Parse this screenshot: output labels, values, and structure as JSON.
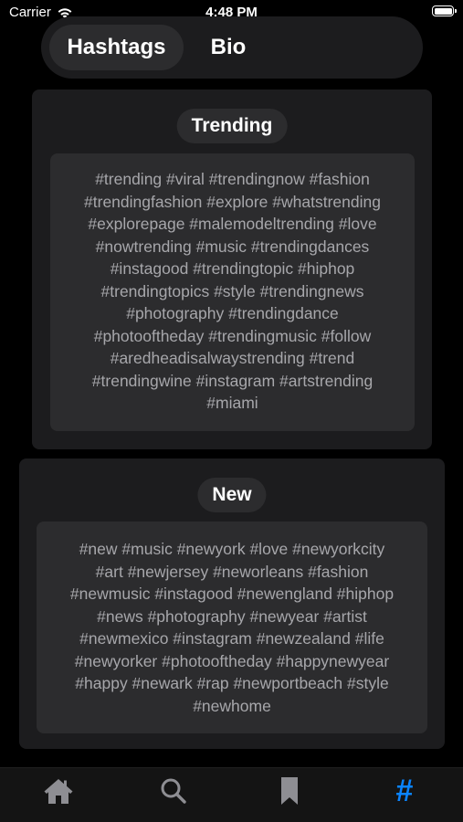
{
  "status_bar": {
    "carrier": "Carrier",
    "time": "4:48 PM"
  },
  "segmented_control": {
    "options": [
      {
        "label": "Hashtags",
        "selected": true
      },
      {
        "label": "Bio",
        "selected": false
      }
    ]
  },
  "sections": [
    {
      "title": "Trending",
      "lines": [
        "#trending #viral #trendingnow #fashion",
        "#trendingfashion #explore #whatstrending",
        "#explorepage #malemodeltrending #love",
        "#nowtrending #music #trendingdances",
        "#instagood #trendingtopic #hiphop",
        "#trendingtopics #style #trendingnews",
        "#photography #trendingdance",
        "#photooftheday #trendingmusic #follow",
        "#aredheadisalwaystrending #trend",
        "#trendingwine #instagram #artstrending",
        "#miami"
      ]
    },
    {
      "title": "New",
      "lines": [
        "#new #music #newyork #love #newyorkcity",
        "#art #newjersey #neworleans #fashion",
        "#newmusic #instagood #newengland #hiphop",
        "#news #photography #newyear #artist",
        "#newmexico #instagram #newzealand #life",
        "#newyorker #photooftheday #happynewyear",
        "#happy #newark #rap #newportbeach #style",
        "#newhome"
      ]
    }
  ],
  "tab_bar": {
    "items": [
      {
        "icon": "home-icon",
        "active": false
      },
      {
        "icon": "search-icon",
        "active": false
      },
      {
        "icon": "bookmark-icon",
        "active": false
      },
      {
        "icon": "hashtag-icon",
        "glyph": "#",
        "active": true
      }
    ],
    "active_color": "#0a84ff",
    "inactive_color": "#8e8e93"
  }
}
